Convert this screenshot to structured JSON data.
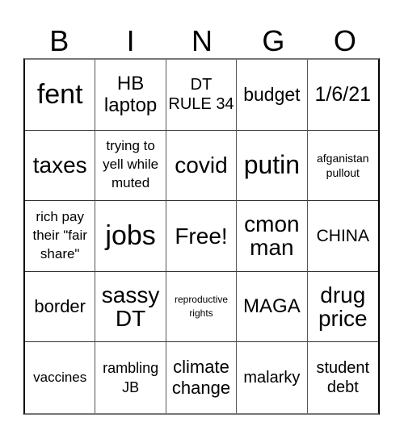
{
  "header": {
    "letters": [
      "B",
      "I",
      "N",
      "G",
      "O"
    ]
  },
  "card": {
    "rows": [
      [
        "fent",
        "HB laptop",
        "DT RULE 34",
        "budget",
        "1/6/21"
      ],
      [
        "taxes",
        "trying to yell while muted",
        "covid",
        "putin",
        "afganistan pullout"
      ],
      [
        "rich pay their \"fair share\"",
        "jobs",
        "Free!",
        "cmon man",
        "CHINA"
      ],
      [
        "border",
        "sassy DT",
        "reproductive rights",
        "MAGA",
        "drug price"
      ],
      [
        "vaccines",
        "rambling JB",
        "climate change",
        "malarky",
        "student debt"
      ]
    ]
  }
}
